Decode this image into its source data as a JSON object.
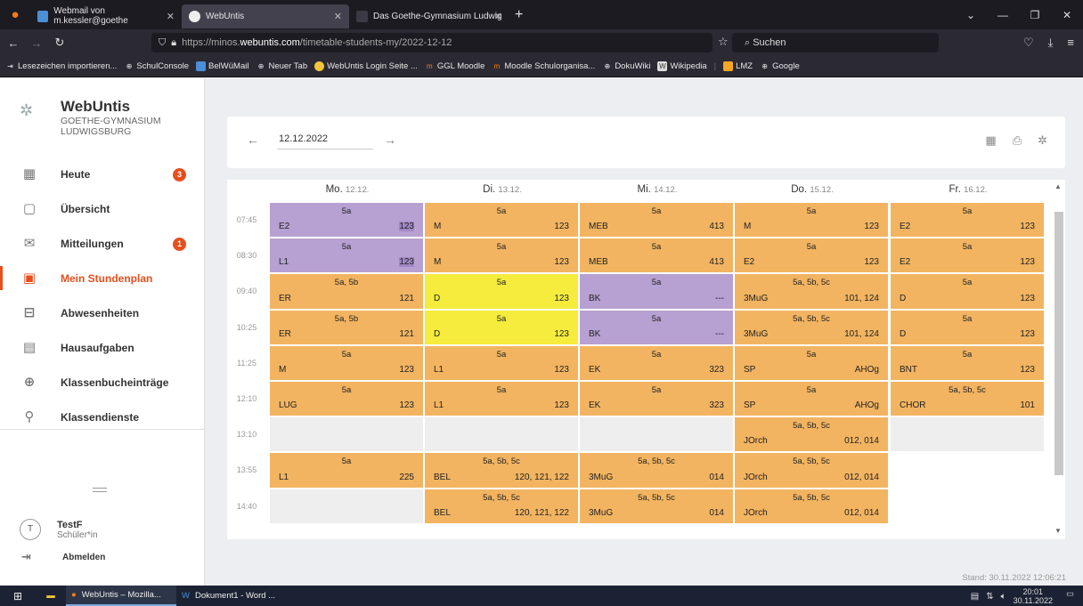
{
  "browser": {
    "tabs": [
      {
        "title": "Webmail von m.kessler@goethe",
        "active": false
      },
      {
        "title": "WebUntis",
        "active": true
      },
      {
        "title": "Das Goethe-Gymnasium Ludwig",
        "active": false
      }
    ],
    "url_prefix": "https://minos.",
    "url_host": "webuntis.com",
    "url_path": "/timetable-students-my/2022-12-12",
    "search_placeholder": "Suchen",
    "bookmarks": [
      "Lesezeichen importieren...",
      "SchulConsole",
      "BelWüMail",
      "Neuer Tab",
      "WebUntis Login Seite ...",
      "GGL Moodle",
      "Moodle Schulorganisa...",
      "DokuWiki",
      "Wikipedia",
      "LMZ",
      "Google"
    ]
  },
  "sidebar": {
    "app_name": "WebUntis",
    "school_line1": "GOETHE-GYMNASIUM",
    "school_line2": "LUDWIGSBURG",
    "items": [
      {
        "label": "Heute",
        "icon": "dashboard-icon",
        "badge": "3"
      },
      {
        "label": "Übersicht",
        "icon": "overview-icon",
        "badge": ""
      },
      {
        "label": "Mitteilungen",
        "icon": "mail-icon",
        "badge": "1"
      },
      {
        "label": "Mein Stundenplan",
        "icon": "calendar-icon",
        "badge": "",
        "active": true
      },
      {
        "label": "Abwesenheiten",
        "icon": "absence-icon",
        "badge": ""
      },
      {
        "label": "Hausaufgaben",
        "icon": "homework-icon",
        "badge": ""
      },
      {
        "label": "Klassenbucheinträge",
        "icon": "classbook-icon",
        "badge": ""
      },
      {
        "label": "Klassendienste",
        "icon": "class-duty-icon",
        "badge": ""
      }
    ],
    "user_initial": "T",
    "user_name": "TestF",
    "user_role": "Schüler*in",
    "logout": "Abmelden"
  },
  "toolbar": {
    "date": "12.12.2022"
  },
  "days": [
    {
      "name": "Mo.",
      "date": "12.12."
    },
    {
      "name": "Di.",
      "date": "13.12."
    },
    {
      "name": "Mi.",
      "date": "14.12."
    },
    {
      "name": "Do.",
      "date": "15.12."
    },
    {
      "name": "Fr.",
      "date": "16.12."
    }
  ],
  "times": [
    "07:45",
    "08:30",
    "09:40",
    "10:25",
    "11:25",
    "12:10",
    "13:10",
    "13:55",
    "14:40"
  ],
  "colors": {
    "orange": "#f2b461",
    "purple": "#b7a0d2",
    "yellow": "#f5ec3d",
    "empty": "#eeeeee",
    "accent": "#e84e1b"
  },
  "lessons": [
    [
      {
        "cls": "5a",
        "subj": "E2",
        "room": "123",
        "color": "purple",
        "hlroom": true
      },
      {
        "cls": "5a",
        "subj": "L1",
        "room": "123",
        "color": "purple",
        "hlroom": true
      },
      {
        "cls": "5a, 5b",
        "subj": "ER",
        "room": "121",
        "color": "orange"
      },
      {
        "cls": "5a, 5b",
        "subj": "ER",
        "room": "121",
        "color": "orange"
      },
      {
        "cls": "5a",
        "subj": "M",
        "room": "123",
        "color": "orange"
      },
      {
        "cls": "5a",
        "subj": "LUG",
        "room": "123",
        "color": "orange"
      },
      null,
      {
        "cls": "5a",
        "subj": "L1",
        "room": "225",
        "color": "orange"
      },
      null
    ],
    [
      {
        "cls": "5a",
        "subj": "M",
        "room": "123",
        "color": "orange"
      },
      {
        "cls": "5a",
        "subj": "M",
        "room": "123",
        "color": "orange"
      },
      {
        "cls": "5a",
        "subj": "D",
        "room": "123",
        "color": "yellow"
      },
      {
        "cls": "5a",
        "subj": "D",
        "room": "123",
        "color": "yellow"
      },
      {
        "cls": "5a",
        "subj": "L1",
        "room": "123",
        "color": "orange"
      },
      {
        "cls": "5a",
        "subj": "L1",
        "room": "123",
        "color": "orange"
      },
      null,
      {
        "cls": "5a, 5b, 5c",
        "subj": "BEL",
        "room": "120, 121, 122",
        "color": "orange"
      },
      {
        "cls": "5a, 5b, 5c",
        "subj": "BEL",
        "room": "120, 121, 122",
        "color": "orange"
      }
    ],
    [
      {
        "cls": "5a",
        "subj": "MEB",
        "room": "413",
        "color": "orange"
      },
      {
        "cls": "5a",
        "subj": "MEB",
        "room": "413",
        "color": "orange"
      },
      {
        "cls": "5a",
        "subj": "BK",
        "room": "---",
        "color": "purple"
      },
      {
        "cls": "5a",
        "subj": "BK",
        "room": "---",
        "color": "purple"
      },
      {
        "cls": "5a",
        "subj": "EK",
        "room": "323",
        "color": "orange"
      },
      {
        "cls": "5a",
        "subj": "EK",
        "room": "323",
        "color": "orange"
      },
      null,
      {
        "cls": "5a, 5b, 5c",
        "subj": "3MuG",
        "room": "014",
        "color": "orange"
      },
      {
        "cls": "5a, 5b, 5c",
        "subj": "3MuG",
        "room": "014",
        "color": "orange"
      }
    ],
    [
      {
        "cls": "5a",
        "subj": "M",
        "room": "123",
        "color": "orange"
      },
      {
        "cls": "5a",
        "subj": "E2",
        "room": "123",
        "color": "orange"
      },
      {
        "cls": "5a, 5b, 5c",
        "subj": "3MuG",
        "room": "101, 124",
        "color": "orange"
      },
      {
        "cls": "5a, 5b, 5c",
        "subj": "3MuG",
        "room": "101, 124",
        "color": "orange"
      },
      {
        "cls": "5a",
        "subj": "SP",
        "room": "AHOg",
        "color": "orange"
      },
      {
        "cls": "5a",
        "subj": "SP",
        "room": "AHOg",
        "color": "orange"
      },
      {
        "cls": "5a, 5b, 5c",
        "subj": "JOrch",
        "room": "012, 014",
        "color": "orange"
      },
      {
        "cls": "5a, 5b, 5c",
        "subj": "JOrch",
        "room": "012, 014",
        "color": "orange"
      },
      {
        "cls": "5a, 5b, 5c",
        "subj": "JOrch",
        "room": "012, 014",
        "color": "orange"
      }
    ],
    [
      {
        "cls": "5a",
        "subj": "E2",
        "room": "123",
        "color": "orange"
      },
      {
        "cls": "5a",
        "subj": "E2",
        "room": "123",
        "color": "orange"
      },
      {
        "cls": "5a",
        "subj": "D",
        "room": "123",
        "color": "orange"
      },
      {
        "cls": "5a",
        "subj": "D",
        "room": "123",
        "color": "orange"
      },
      {
        "cls": "5a",
        "subj": "BNT",
        "room": "123",
        "color": "orange"
      },
      {
        "cls": "5a, 5b, 5c",
        "subj": "CHOR",
        "room": "101",
        "color": "orange"
      },
      null,
      null,
      null
    ]
  ],
  "stand": "Stand: 30.11.2022 12:06:21",
  "taskbar": {
    "app1": "WebUntis – Mozilla...",
    "app2": "Dokument1 - Word ...",
    "time": "20:01",
    "date": "30.11.2022"
  }
}
